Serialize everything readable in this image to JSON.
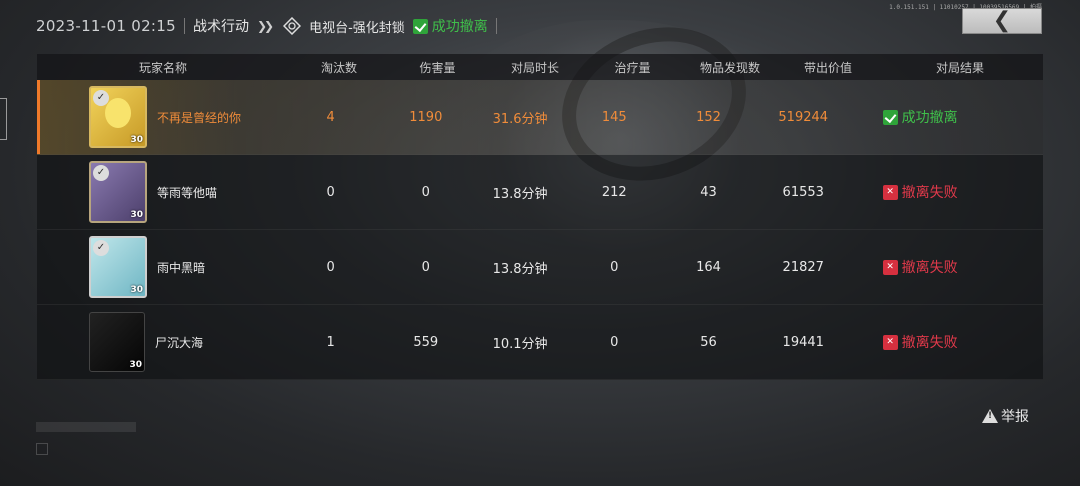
{
  "header": {
    "timestamp": "2023-11-01 02:15",
    "mode": "战术行动",
    "map": "电视台-强化封锁",
    "status": "成功撤离",
    "top_info": "1.0.151.151 | 11010257 | 10039516569 | 拍摄"
  },
  "table": {
    "headers": [
      "玩家名称",
      "淘汰数",
      "伤害量",
      "对局时长",
      "治疗量",
      "物品发现数",
      "带出价值",
      "对局结果"
    ],
    "rows": [
      {
        "name": "不再是曾经的你",
        "level": "30",
        "kills": "4",
        "damage": "1190",
        "duration": "31.6分钟",
        "heal": "145",
        "items": "152",
        "value": "519244",
        "result": "成功撤离",
        "result_type": "success",
        "highlight": true
      },
      {
        "name": "等雨等他喵",
        "level": "30",
        "kills": "0",
        "damage": "0",
        "duration": "13.8分钟",
        "heal": "212",
        "items": "43",
        "value": "61553",
        "result": "撤离失败",
        "result_type": "fail",
        "highlight": false
      },
      {
        "name": "雨中黑暗",
        "level": "30",
        "kills": "0",
        "damage": "0",
        "duration": "13.8分钟",
        "heal": "0",
        "items": "164",
        "value": "21827",
        "result": "撤离失败",
        "result_type": "fail",
        "highlight": false
      },
      {
        "name": "尸沉大海",
        "level": "30",
        "kills": "1",
        "damage": "559",
        "duration": "10.1分钟",
        "heal": "0",
        "items": "56",
        "value": "19441",
        "result": "撤离失败",
        "result_type": "fail",
        "highlight": false
      }
    ]
  },
  "report_label": "举报",
  "colors": {
    "accent_orange": "#f08c3a",
    "success_green": "#3fbf4a",
    "fail_red": "#e0394a"
  }
}
